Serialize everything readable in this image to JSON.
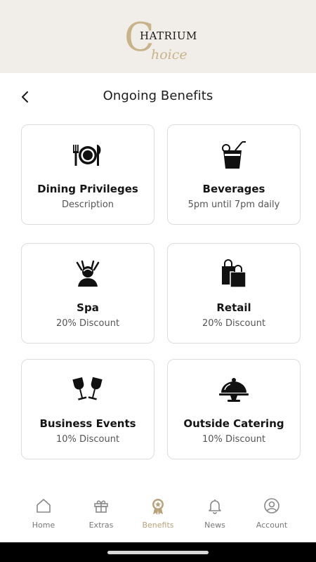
{
  "brand": {
    "logo_primary": "HATRIUM",
    "logo_initial": "C",
    "logo_secondary": "hoice",
    "accent_color": "#c9b48a",
    "header_bg": "#f1ede8"
  },
  "page": {
    "title": "Ongoing Benefits",
    "back_icon": "chevron-left-icon"
  },
  "benefits": [
    {
      "title": "Dining Privileges",
      "subtitle": "Description",
      "icon": "dining-plate-icon"
    },
    {
      "title": "Beverages",
      "subtitle": "5pm until 7pm daily",
      "icon": "beverage-glass-icon"
    },
    {
      "title": "Spa",
      "subtitle": "20% Discount",
      "icon": "spa-massage-icon"
    },
    {
      "title": "Retail",
      "subtitle": "20% Discount",
      "icon": "shopping-bags-icon"
    },
    {
      "title": "Business Events",
      "subtitle": "10% Discount",
      "icon": "wine-glasses-icon"
    },
    {
      "title": "Outside Catering",
      "subtitle": "10% Discount",
      "icon": "cloche-icon"
    }
  ],
  "nav": {
    "items": [
      {
        "label": "Home",
        "icon": "home-icon",
        "active": false
      },
      {
        "label": "Extras",
        "icon": "gift-icon",
        "active": false
      },
      {
        "label": "Benefits",
        "icon": "award-icon",
        "active": true
      },
      {
        "label": "News",
        "icon": "bell-icon",
        "active": false
      },
      {
        "label": "Account",
        "icon": "user-circle-icon",
        "active": false
      }
    ],
    "active_color": "#b9a27a",
    "inactive_color": "#777777"
  }
}
